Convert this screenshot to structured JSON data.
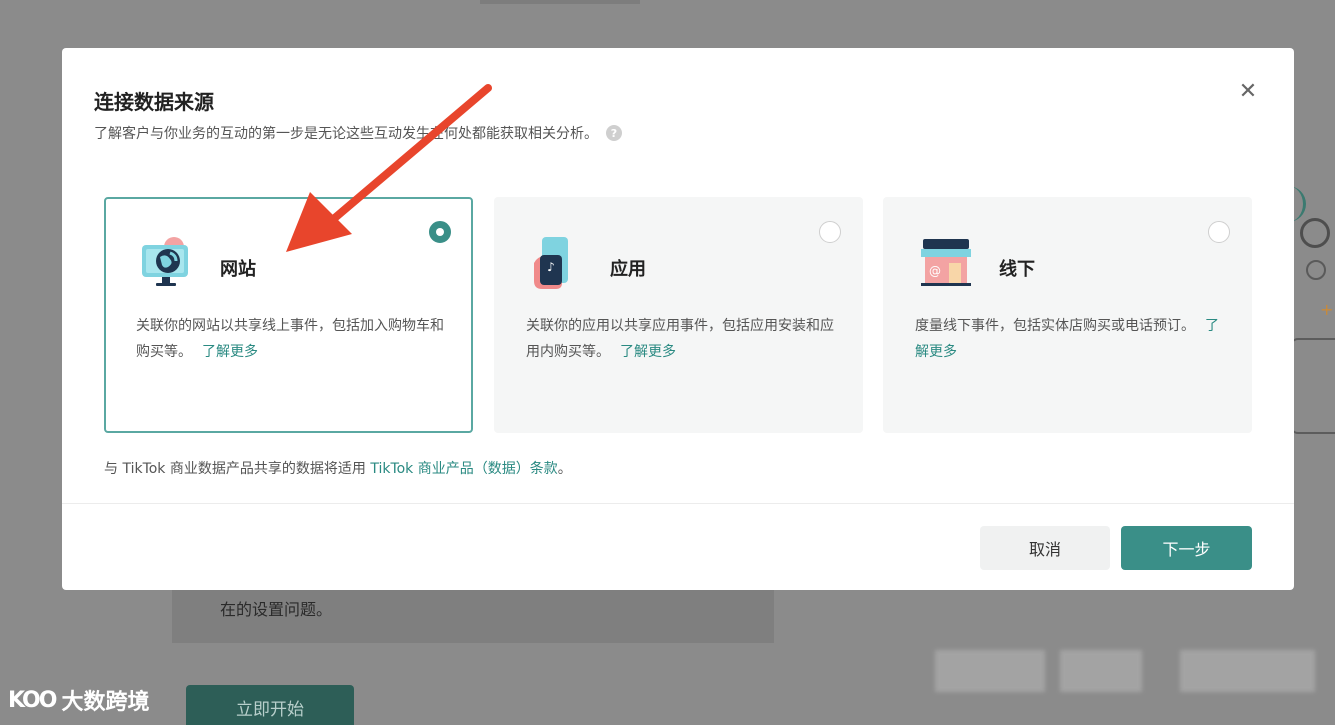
{
  "modal": {
    "title": "连接数据来源",
    "subtitle": "了解客户与你业务的互动的第一步是无论这些互动发生在何处都能获取相关分析。",
    "help_icon": "question-icon",
    "close_icon": "close-icon",
    "options": [
      {
        "label": "网站",
        "icon": "website-globe-icon",
        "description": "关联你的网站以共享线上事件，包括加入购物车和购买等。",
        "link": "了解更多",
        "selected": true
      },
      {
        "label": "应用",
        "icon": "app-phone-icon",
        "description": "关联你的应用以共享应用事件，包括应用安装和应用内购买等。",
        "link": "了解更多",
        "selected": false
      },
      {
        "label": "线下",
        "icon": "offline-store-icon",
        "description": "度量线下事件，包括实体店购买或电话预订。",
        "link": "了解更多",
        "selected": false
      }
    ],
    "terms_prefix": "与 TikTok 商业数据产品共享的数据将适用",
    "terms_link": "TikTok 商业产品（数据）条款",
    "terms_suffix": "。",
    "cancel_label": "取消",
    "next_label": "下一步"
  },
  "background": {
    "card_text": "在的设置问题。",
    "start_button": "立即开始"
  },
  "watermark": {
    "logo": "KOO",
    "text": "大数跨境"
  },
  "colors": {
    "accent": "#3a8f88",
    "link": "#2a8a82",
    "arrow": "#e8452c"
  }
}
